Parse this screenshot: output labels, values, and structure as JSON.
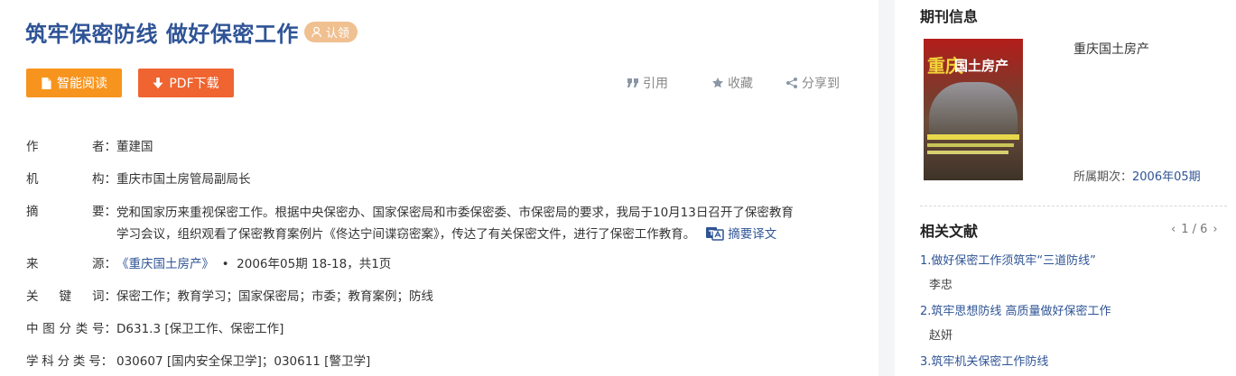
{
  "article": {
    "title": "筑牢保密防线 做好保密工作",
    "claim_label": "认领"
  },
  "toolbar": {
    "read_label": "智能阅读",
    "pdf_label": "PDF下载",
    "cite_label": "引用",
    "fav_label": "收藏",
    "share_label": "分享到"
  },
  "meta": {
    "author_label": [
      "作",
      "者："
    ],
    "author": "董建国",
    "org_label": [
      "机",
      "构："
    ],
    "org": "重庆市国土房管局副局长",
    "abstract_label": [
      "摘",
      "要："
    ],
    "abstract_line1": "党和国家历来重视保密工作。根据中央保密办、国家保密局和市委保密委、市保密局的要求，我局于10月13日召开了保密教育",
    "abstract_line2": "学习会议，组织观看了保密教育案例片《佟达宁间谍窃密案》，传达了有关保密文件，进行了保密工作教育。",
    "translate_label": "摘要译文",
    "source_label": [
      "来",
      "源："
    ],
    "source_journal": "《重庆国土房产》",
    "source_sep": "•",
    "source_detail": "2006年05期 18-18，共1页",
    "keywords_label": [
      "关",
      "键",
      "词："
    ],
    "keywords": "保密工作；教育学习；国家保密局；市委；教育案例；防线",
    "clc_label": [
      "中",
      "图",
      "分",
      "类",
      "号："
    ],
    "clc": "D631.3 [保卫工作、保密工作]",
    "subject_label": [
      "学",
      "科",
      "分",
      "类",
      "号："
    ],
    "subject": "030607 [国内安全保卫学]；030611 [警卫学]"
  },
  "journal": {
    "section_title": "期刊信息",
    "name": "重庆国土房产",
    "issue_label": "所属期次：",
    "issue": "2006年05期"
  },
  "related": {
    "section_title": "相关文献",
    "pager": "1 / 6",
    "items": [
      {
        "title": "1.做好保密工作须筑牢“三道防线”",
        "author": "李忠"
      },
      {
        "title": "2.筑牢思想防线 高质量做好保密工作",
        "author": "赵妍"
      },
      {
        "title": "3.筑牢机关保密工作防线",
        "author": ""
      }
    ]
  },
  "colors": {
    "title_blue": "#2f5496",
    "read_orange": "#f7941d",
    "pdf_orange": "#ef6430",
    "claim_tan": "#f0c090"
  }
}
